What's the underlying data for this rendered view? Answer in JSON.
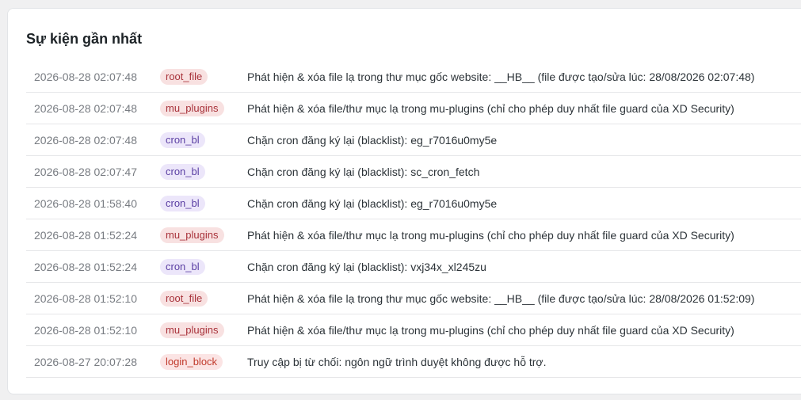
{
  "section": {
    "title": "Sự kiện gần nhất"
  },
  "events": [
    {
      "time": "2026-08-28 02:07:48",
      "type": "root_file",
      "message": "Phát hiện & xóa file lạ trong thư mục gốc website: __HB__ (file được tạo/sửa lúc: 28/08/2026 02:07:48)"
    },
    {
      "time": "2026-08-28 02:07:48",
      "type": "mu_plugins",
      "message": "Phát hiện & xóa file/thư mục lạ trong mu-plugins (chỉ cho phép duy nhất file guard của XD Security)"
    },
    {
      "time": "2026-08-28 02:07:48",
      "type": "cron_bl",
      "message": "Chặn cron đăng ký lại (blacklist): eg_r7016u0my5e"
    },
    {
      "time": "2026-08-28 02:07:47",
      "type": "cron_bl",
      "message": "Chặn cron đăng ký lại (blacklist): sc_cron_fetch"
    },
    {
      "time": "2026-08-28 01:58:40",
      "type": "cron_bl",
      "message": "Chặn cron đăng ký lại (blacklist): eg_r7016u0my5e"
    },
    {
      "time": "2026-08-28 01:52:24",
      "type": "mu_plugins",
      "message": "Phát hiện & xóa file/thư mục lạ trong mu-plugins (chỉ cho phép duy nhất file guard của XD Security)"
    },
    {
      "time": "2026-08-28 01:52:24",
      "type": "cron_bl",
      "message": "Chặn cron đăng ký lại (blacklist): vxj34x_xl245zu"
    },
    {
      "time": "2026-08-28 01:52:10",
      "type": "root_file",
      "message": "Phát hiện & xóa file lạ trong thư mục gốc website: __HB__ (file được tạo/sửa lúc: 28/08/2026 01:52:09)"
    },
    {
      "time": "2026-08-28 01:52:10",
      "type": "mu_plugins",
      "message": "Phát hiện & xóa file/thư mục lạ trong mu-plugins (chỉ cho phép duy nhất file guard của XD Security)"
    },
    {
      "time": "2026-08-27 20:07:28",
      "type": "login_block",
      "message": "Truy cập bị từ chối: ngôn ngữ trình duyệt không được hỗ trợ."
    }
  ],
  "badge_colors": {
    "root_file": {
      "bg": "#f8e1e1",
      "fg": "#a8323a"
    },
    "mu_plugins": {
      "bg": "#f8e1e1",
      "fg": "#a8323a"
    },
    "cron_bl": {
      "bg": "#ece6fa",
      "fg": "#5b3fa3"
    },
    "login_block": {
      "bg": "#fbe4e4",
      "fg": "#c0392b"
    }
  }
}
